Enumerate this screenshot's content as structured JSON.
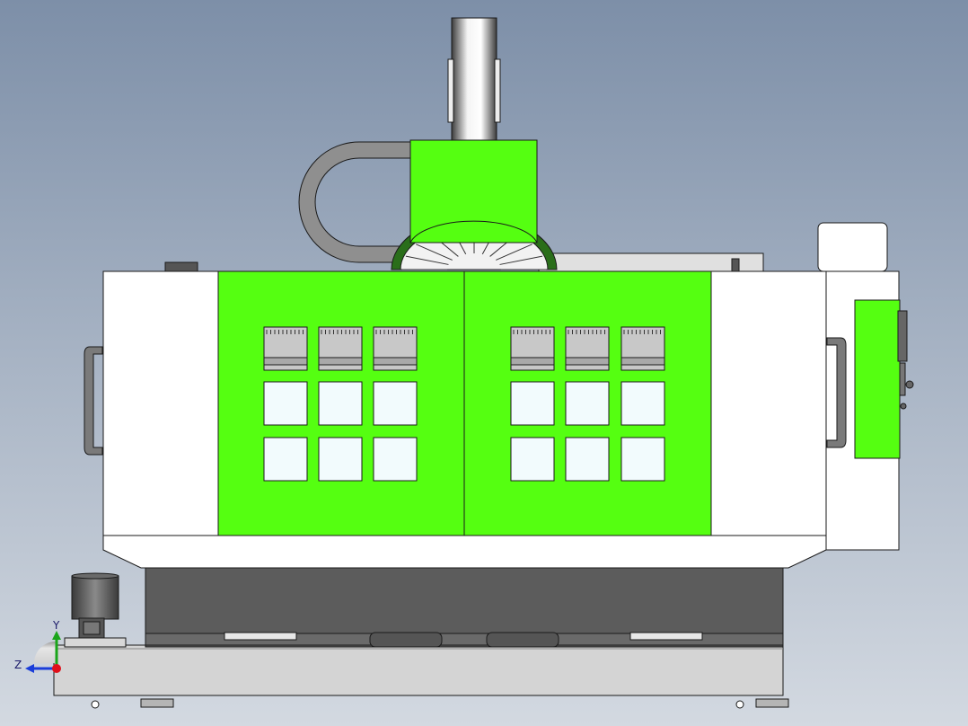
{
  "viewport": {
    "background_top": "#7d8fa8",
    "background_bottom": "#d3d9e1"
  },
  "model": {
    "panel_color": "#55ff11",
    "body_color": "#ffffff",
    "base_color": "#5c5c5c",
    "outline_color": "#1a1a1a"
  },
  "triad": {
    "y_label": "Y",
    "z_label": "Z",
    "y_color": "#1aa51a",
    "z_color": "#1a3dd9",
    "x_color": "#e0101a"
  }
}
